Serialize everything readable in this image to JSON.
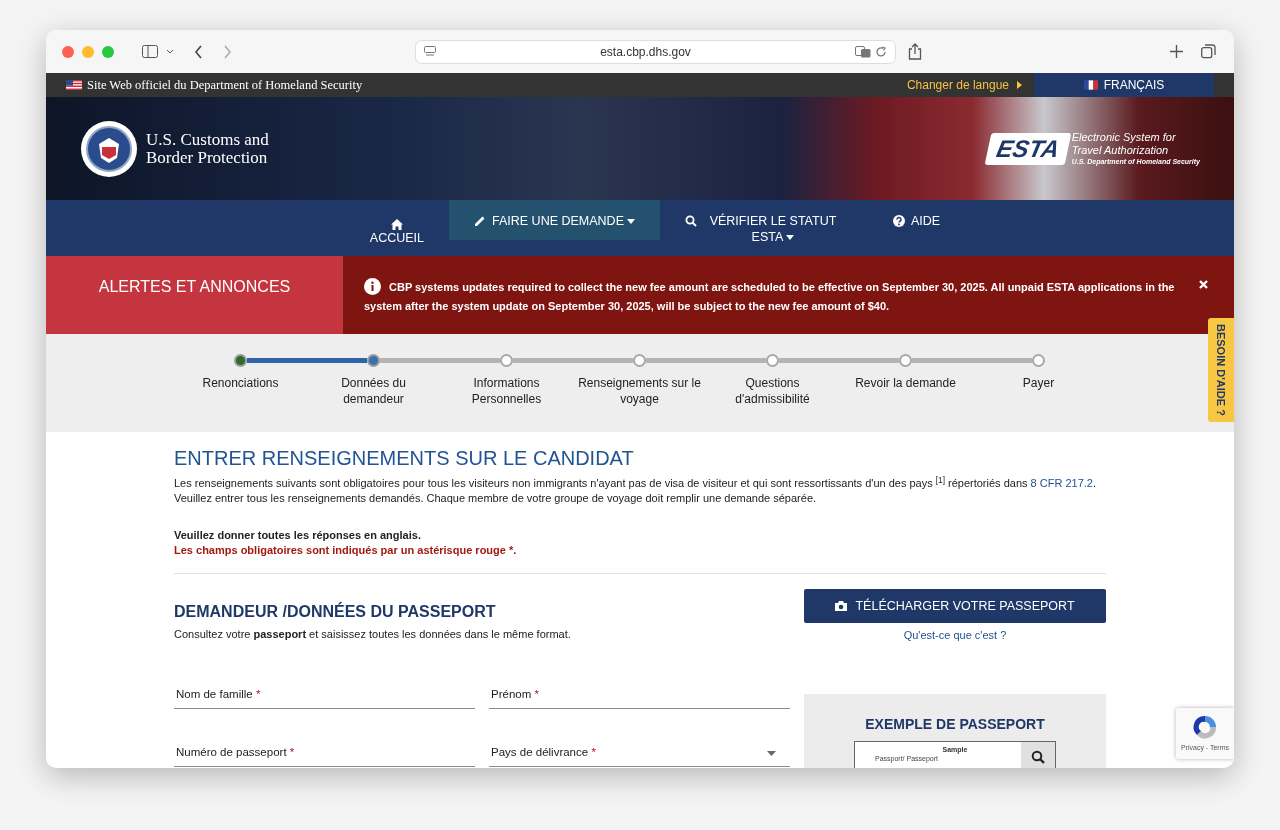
{
  "browser": {
    "url": "esta.cbp.dhs.gov"
  },
  "gov_bar": {
    "text": "Site Web officiel du Department of Homeland Security",
    "language_link": "Changer de langue",
    "language": "FRANÇAIS"
  },
  "header": {
    "agency": [
      "U.S. Customs and",
      "Border Protection"
    ],
    "logo": {
      "mark": "ESTA",
      "line1": "Electronic System for",
      "line2": "Travel Authorization",
      "line3": "U.S. Department of Homeland Security"
    }
  },
  "nav": [
    {
      "kind": "stacked",
      "label": "ACCUEIL",
      "dropdown": false,
      "selected": false
    },
    {
      "kind": "inline",
      "label": "FAIRE UNE DEMANDE",
      "dropdown": true,
      "selected": true
    },
    {
      "kind": "inline",
      "label": "VÉRIFIER LE STATUT ESTA",
      "dropdown": true,
      "selected": false
    },
    {
      "kind": "inline",
      "label": "AIDE",
      "dropdown": false,
      "selected": false
    }
  ],
  "alerts": {
    "title": "ALERTES ET ANNONCES",
    "message": "CBP systems updates required to collect the new fee amount are scheduled to be effective on September 30, 2025. All unpaid ESTA applications in the system after the system update on September 30, 2025, will be subject to the new fee amount of $40."
  },
  "steps": [
    {
      "label": "Renonciations",
      "done": true,
      "current": false
    },
    {
      "label": "Données du demandeur",
      "done": false,
      "current": true
    },
    {
      "label": "Informations Personnelles",
      "done": false,
      "current": false
    },
    {
      "label": "Renseignements sur le voyage",
      "done": false,
      "current": false
    },
    {
      "label": "Questions d'admissibilité",
      "done": false,
      "current": false
    },
    {
      "label": "Revoir la demande",
      "done": false,
      "current": false
    },
    {
      "label": "Payer",
      "done": false,
      "current": false
    }
  ],
  "help_tab": "BESOIN D'AIDE ?",
  "intro": {
    "title": "ENTRER RENSEIGNEMENTS SUR LE CANDIDAT",
    "text_before": "Les renseignements suivants sont obligatoires pour tous les visiteurs non immigrants n'ayant pas de visa de visiteur et qui sont ressortissants d'un des pays $^{[1]}$ répertoriés dans",
    "link": "8 CFR 217.2",
    "text_after": ". Veuillez entrer tous les renseignements demandés. Chaque membre de votre groupe de voyage doit remplir une demande séparée.",
    "english_note": "Veuillez donner toutes les réponses en anglais.",
    "required_note": "Les champs obligatoires sont indiqués par un astérisque rouge *."
  },
  "passport_section": {
    "title": "DEMANDEUR /DONNÉES DU PASSEPORT",
    "instruction": "Consultez votre **passeport** et saisissez toutes les données dans le même format.",
    "upload_button": "TÉLÉCHARGER VOTRE PASSEPORT",
    "what_is_it": "Qu'est-ce que c'est ?",
    "fields": [
      {
        "kind": "text",
        "label": "Nom de famille",
        "required_mark": "*"
      },
      {
        "kind": "text",
        "label": "Prénom",
        "required_mark": "*"
      },
      {
        "kind": "text",
        "label": "Numéro de passeport",
        "required_mark": "*"
      },
      {
        "kind": "select",
        "label": "Pays de délivrance",
        "required_mark": "*"
      }
    ],
    "sample": {
      "title": "EXEMPLE DE PASSEPORT",
      "card_title": "Sample",
      "card_label": "Passport/ Passeport"
    }
  },
  "recaptcha": {
    "links": "Privacy - Terms"
  }
}
